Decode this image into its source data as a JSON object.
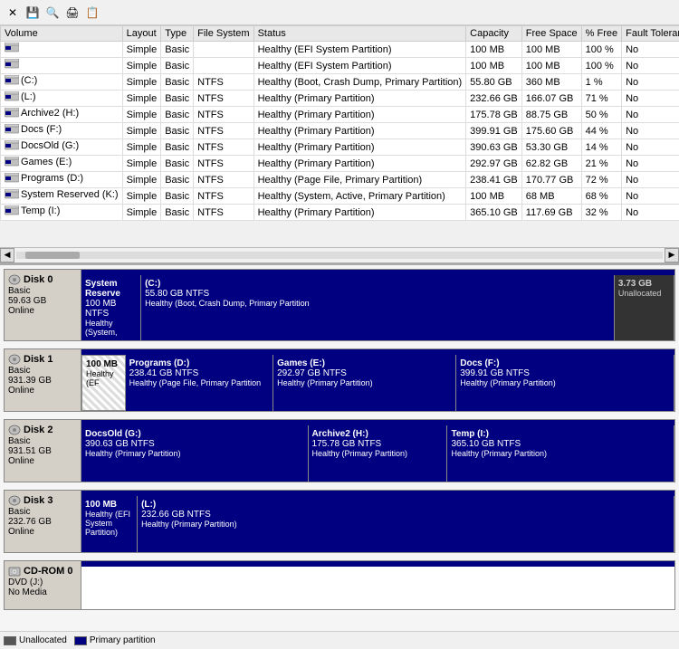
{
  "toolbar": {
    "buttons": [
      "✕",
      "💾",
      "🔍",
      "🖨",
      "📋"
    ]
  },
  "table": {
    "columns": [
      "Volume",
      "Layout",
      "Type",
      "File System",
      "Status",
      "Capacity",
      "Free Space",
      "% Free",
      "Fault Tolerance"
    ],
    "rows": [
      {
        "volume": "",
        "layout": "Simple",
        "type": "Basic",
        "fs": "",
        "status": "Healthy (EFI System Partition)",
        "capacity": "100 MB",
        "free": "100 MB",
        "pct": "100 %",
        "ft": "No"
      },
      {
        "volume": "",
        "layout": "Simple",
        "type": "Basic",
        "fs": "",
        "status": "Healthy (EFI System Partition)",
        "capacity": "100 MB",
        "free": "100 MB",
        "pct": "100 %",
        "ft": "No"
      },
      {
        "volume": "(C:)",
        "layout": "Simple",
        "type": "Basic",
        "fs": "NTFS",
        "status": "Healthy (Boot, Crash Dump, Primary Partition)",
        "capacity": "55.80 GB",
        "free": "360 MB",
        "pct": "1 %",
        "ft": "No"
      },
      {
        "volume": "(L:)",
        "layout": "Simple",
        "type": "Basic",
        "fs": "NTFS",
        "status": "Healthy (Primary Partition)",
        "capacity": "232.66 GB",
        "free": "166.07 GB",
        "pct": "71 %",
        "ft": "No"
      },
      {
        "volume": "Archive2 (H:)",
        "layout": "Simple",
        "type": "Basic",
        "fs": "NTFS",
        "status": "Healthy (Primary Partition)",
        "capacity": "175.78 GB",
        "free": "88.75 GB",
        "pct": "50 %",
        "ft": "No"
      },
      {
        "volume": "Docs (F:)",
        "layout": "Simple",
        "type": "Basic",
        "fs": "NTFS",
        "status": "Healthy (Primary Partition)",
        "capacity": "399.91 GB",
        "free": "175.60 GB",
        "pct": "44 %",
        "ft": "No"
      },
      {
        "volume": "DocsOld (G:)",
        "layout": "Simple",
        "type": "Basic",
        "fs": "NTFS",
        "status": "Healthy (Primary Partition)",
        "capacity": "390.63 GB",
        "free": "53.30 GB",
        "pct": "14 %",
        "ft": "No"
      },
      {
        "volume": "Games (E:)",
        "layout": "Simple",
        "type": "Basic",
        "fs": "NTFS",
        "status": "Healthy (Primary Partition)",
        "capacity": "292.97 GB",
        "free": "62.82 GB",
        "pct": "21 %",
        "ft": "No"
      },
      {
        "volume": "Programs (D:)",
        "layout": "Simple",
        "type": "Basic",
        "fs": "NTFS",
        "status": "Healthy (Page File, Primary Partition)",
        "capacity": "238.41 GB",
        "free": "170.77 GB",
        "pct": "72 %",
        "ft": "No"
      },
      {
        "volume": "System Reserved (K:)",
        "layout": "Simple",
        "type": "Basic",
        "fs": "NTFS",
        "status": "Healthy (System, Active, Primary Partition)",
        "capacity": "100 MB",
        "free": "68 MB",
        "pct": "68 %",
        "ft": "No"
      },
      {
        "volume": "Temp (I:)",
        "layout": "Simple",
        "type": "Basic",
        "fs": "NTFS",
        "status": "Healthy (Primary Partition)",
        "capacity": "365.10 GB",
        "free": "117.69 GB",
        "pct": "32 %",
        "ft": "No"
      }
    ]
  },
  "disks": [
    {
      "name": "Disk 0",
      "type": "Basic",
      "size": "59.63 GB",
      "status": "Online",
      "partitions": [
        {
          "name": "System Reserve",
          "size": "100 MB NTFS",
          "status": "Healthy (System,",
          "style": "blue",
          "flex": 1
        },
        {
          "name": "(C:)",
          "size": "55.80 GB NTFS",
          "status": "Healthy (Boot, Crash Dump, Primary Partition",
          "style": "blue",
          "flex": 9
        },
        {
          "name": "3.73 GB",
          "size": "",
          "status": "Unallocated",
          "style": "unalloc",
          "flex": 1
        }
      ]
    },
    {
      "name": "Disk 1",
      "type": "Basic",
      "size": "931.39 GB",
      "status": "Online",
      "partitions": [
        {
          "name": "100 MB",
          "size": "",
          "status": "Healthy (EF",
          "style": "stripe",
          "flex": 1
        },
        {
          "name": "Programs (D:)",
          "size": "238.41 GB NTFS",
          "status": "Healthy (Page File, Primary Partition",
          "style": "blue",
          "flex": 4
        },
        {
          "name": "Games (E:)",
          "size": "292.97 GB NTFS",
          "status": "Healthy (Primary Partition)",
          "style": "blue",
          "flex": 5
        },
        {
          "name": "Docs (F:)",
          "size": "399.91 GB NTFS",
          "status": "Healthy (Primary Partition)",
          "style": "blue",
          "flex": 6
        }
      ]
    },
    {
      "name": "Disk 2",
      "type": "Basic",
      "size": "931.51 GB",
      "status": "Online",
      "partitions": [
        {
          "name": "DocsOld (G:)",
          "size": "390.63 GB NTFS",
          "status": "Healthy (Primary Partition)",
          "style": "blue",
          "flex": 5
        },
        {
          "name": "Archive2 (H:)",
          "size": "175.78 GB NTFS",
          "status": "Healthy (Primary Partition)",
          "style": "blue",
          "flex": 3
        },
        {
          "name": "Temp (I:)",
          "size": "365.10 GB NTFS",
          "status": "Healthy (Primary Partition)",
          "style": "blue",
          "flex": 5
        }
      ]
    },
    {
      "name": "Disk 3",
      "type": "Basic",
      "size": "232.76 GB",
      "status": "Online",
      "partitions": [
        {
          "name": "100 MB",
          "size": "",
          "status": "Healthy (EFI System Partition)",
          "style": "blue",
          "flex": 1
        },
        {
          "name": "(L:)",
          "size": "232.66 GB NTFS",
          "status": "Healthy (Primary Partition)",
          "style": "blue",
          "flex": 11
        }
      ]
    }
  ],
  "cdrom": {
    "name": "CD-ROM 0",
    "type": "DVD",
    "drive": "(J:)",
    "status": "No Media"
  },
  "legend": {
    "items": [
      {
        "label": "Unallocated",
        "color": "#555"
      },
      {
        "label": "Primary partition",
        "color": "#000080"
      }
    ]
  }
}
